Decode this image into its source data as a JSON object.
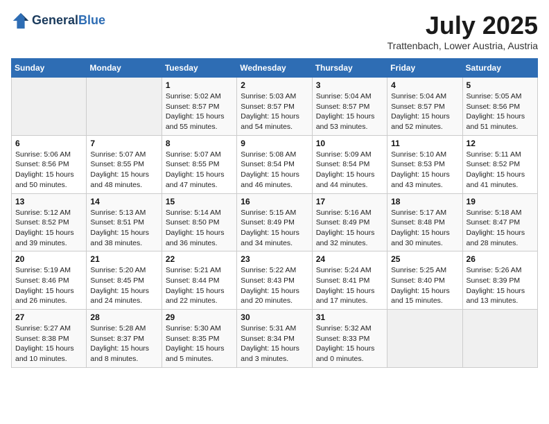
{
  "header": {
    "logo_line1": "General",
    "logo_line2": "Blue",
    "month_title": "July 2025",
    "location": "Trattenbach, Lower Austria, Austria"
  },
  "days_of_week": [
    "Sunday",
    "Monday",
    "Tuesday",
    "Wednesday",
    "Thursday",
    "Friday",
    "Saturday"
  ],
  "weeks": [
    [
      {
        "day": "",
        "info": ""
      },
      {
        "day": "",
        "info": ""
      },
      {
        "day": "1",
        "info": "Sunrise: 5:02 AM\nSunset: 8:57 PM\nDaylight: 15 hours\nand 55 minutes."
      },
      {
        "day": "2",
        "info": "Sunrise: 5:03 AM\nSunset: 8:57 PM\nDaylight: 15 hours\nand 54 minutes."
      },
      {
        "day": "3",
        "info": "Sunrise: 5:04 AM\nSunset: 8:57 PM\nDaylight: 15 hours\nand 53 minutes."
      },
      {
        "day": "4",
        "info": "Sunrise: 5:04 AM\nSunset: 8:57 PM\nDaylight: 15 hours\nand 52 minutes."
      },
      {
        "day": "5",
        "info": "Sunrise: 5:05 AM\nSunset: 8:56 PM\nDaylight: 15 hours\nand 51 minutes."
      }
    ],
    [
      {
        "day": "6",
        "info": "Sunrise: 5:06 AM\nSunset: 8:56 PM\nDaylight: 15 hours\nand 50 minutes."
      },
      {
        "day": "7",
        "info": "Sunrise: 5:07 AM\nSunset: 8:55 PM\nDaylight: 15 hours\nand 48 minutes."
      },
      {
        "day": "8",
        "info": "Sunrise: 5:07 AM\nSunset: 8:55 PM\nDaylight: 15 hours\nand 47 minutes."
      },
      {
        "day": "9",
        "info": "Sunrise: 5:08 AM\nSunset: 8:54 PM\nDaylight: 15 hours\nand 46 minutes."
      },
      {
        "day": "10",
        "info": "Sunrise: 5:09 AM\nSunset: 8:54 PM\nDaylight: 15 hours\nand 44 minutes."
      },
      {
        "day": "11",
        "info": "Sunrise: 5:10 AM\nSunset: 8:53 PM\nDaylight: 15 hours\nand 43 minutes."
      },
      {
        "day": "12",
        "info": "Sunrise: 5:11 AM\nSunset: 8:52 PM\nDaylight: 15 hours\nand 41 minutes."
      }
    ],
    [
      {
        "day": "13",
        "info": "Sunrise: 5:12 AM\nSunset: 8:52 PM\nDaylight: 15 hours\nand 39 minutes."
      },
      {
        "day": "14",
        "info": "Sunrise: 5:13 AM\nSunset: 8:51 PM\nDaylight: 15 hours\nand 38 minutes."
      },
      {
        "day": "15",
        "info": "Sunrise: 5:14 AM\nSunset: 8:50 PM\nDaylight: 15 hours\nand 36 minutes."
      },
      {
        "day": "16",
        "info": "Sunrise: 5:15 AM\nSunset: 8:49 PM\nDaylight: 15 hours\nand 34 minutes."
      },
      {
        "day": "17",
        "info": "Sunrise: 5:16 AM\nSunset: 8:49 PM\nDaylight: 15 hours\nand 32 minutes."
      },
      {
        "day": "18",
        "info": "Sunrise: 5:17 AM\nSunset: 8:48 PM\nDaylight: 15 hours\nand 30 minutes."
      },
      {
        "day": "19",
        "info": "Sunrise: 5:18 AM\nSunset: 8:47 PM\nDaylight: 15 hours\nand 28 minutes."
      }
    ],
    [
      {
        "day": "20",
        "info": "Sunrise: 5:19 AM\nSunset: 8:46 PM\nDaylight: 15 hours\nand 26 minutes."
      },
      {
        "day": "21",
        "info": "Sunrise: 5:20 AM\nSunset: 8:45 PM\nDaylight: 15 hours\nand 24 minutes."
      },
      {
        "day": "22",
        "info": "Sunrise: 5:21 AM\nSunset: 8:44 PM\nDaylight: 15 hours\nand 22 minutes."
      },
      {
        "day": "23",
        "info": "Sunrise: 5:22 AM\nSunset: 8:43 PM\nDaylight: 15 hours\nand 20 minutes."
      },
      {
        "day": "24",
        "info": "Sunrise: 5:24 AM\nSunset: 8:41 PM\nDaylight: 15 hours\nand 17 minutes."
      },
      {
        "day": "25",
        "info": "Sunrise: 5:25 AM\nSunset: 8:40 PM\nDaylight: 15 hours\nand 15 minutes."
      },
      {
        "day": "26",
        "info": "Sunrise: 5:26 AM\nSunset: 8:39 PM\nDaylight: 15 hours\nand 13 minutes."
      }
    ],
    [
      {
        "day": "27",
        "info": "Sunrise: 5:27 AM\nSunset: 8:38 PM\nDaylight: 15 hours\nand 10 minutes."
      },
      {
        "day": "28",
        "info": "Sunrise: 5:28 AM\nSunset: 8:37 PM\nDaylight: 15 hours\nand 8 minutes."
      },
      {
        "day": "29",
        "info": "Sunrise: 5:30 AM\nSunset: 8:35 PM\nDaylight: 15 hours\nand 5 minutes."
      },
      {
        "day": "30",
        "info": "Sunrise: 5:31 AM\nSunset: 8:34 PM\nDaylight: 15 hours\nand 3 minutes."
      },
      {
        "day": "31",
        "info": "Sunrise: 5:32 AM\nSunset: 8:33 PM\nDaylight: 15 hours\nand 0 minutes."
      },
      {
        "day": "",
        "info": ""
      },
      {
        "day": "",
        "info": ""
      }
    ]
  ]
}
